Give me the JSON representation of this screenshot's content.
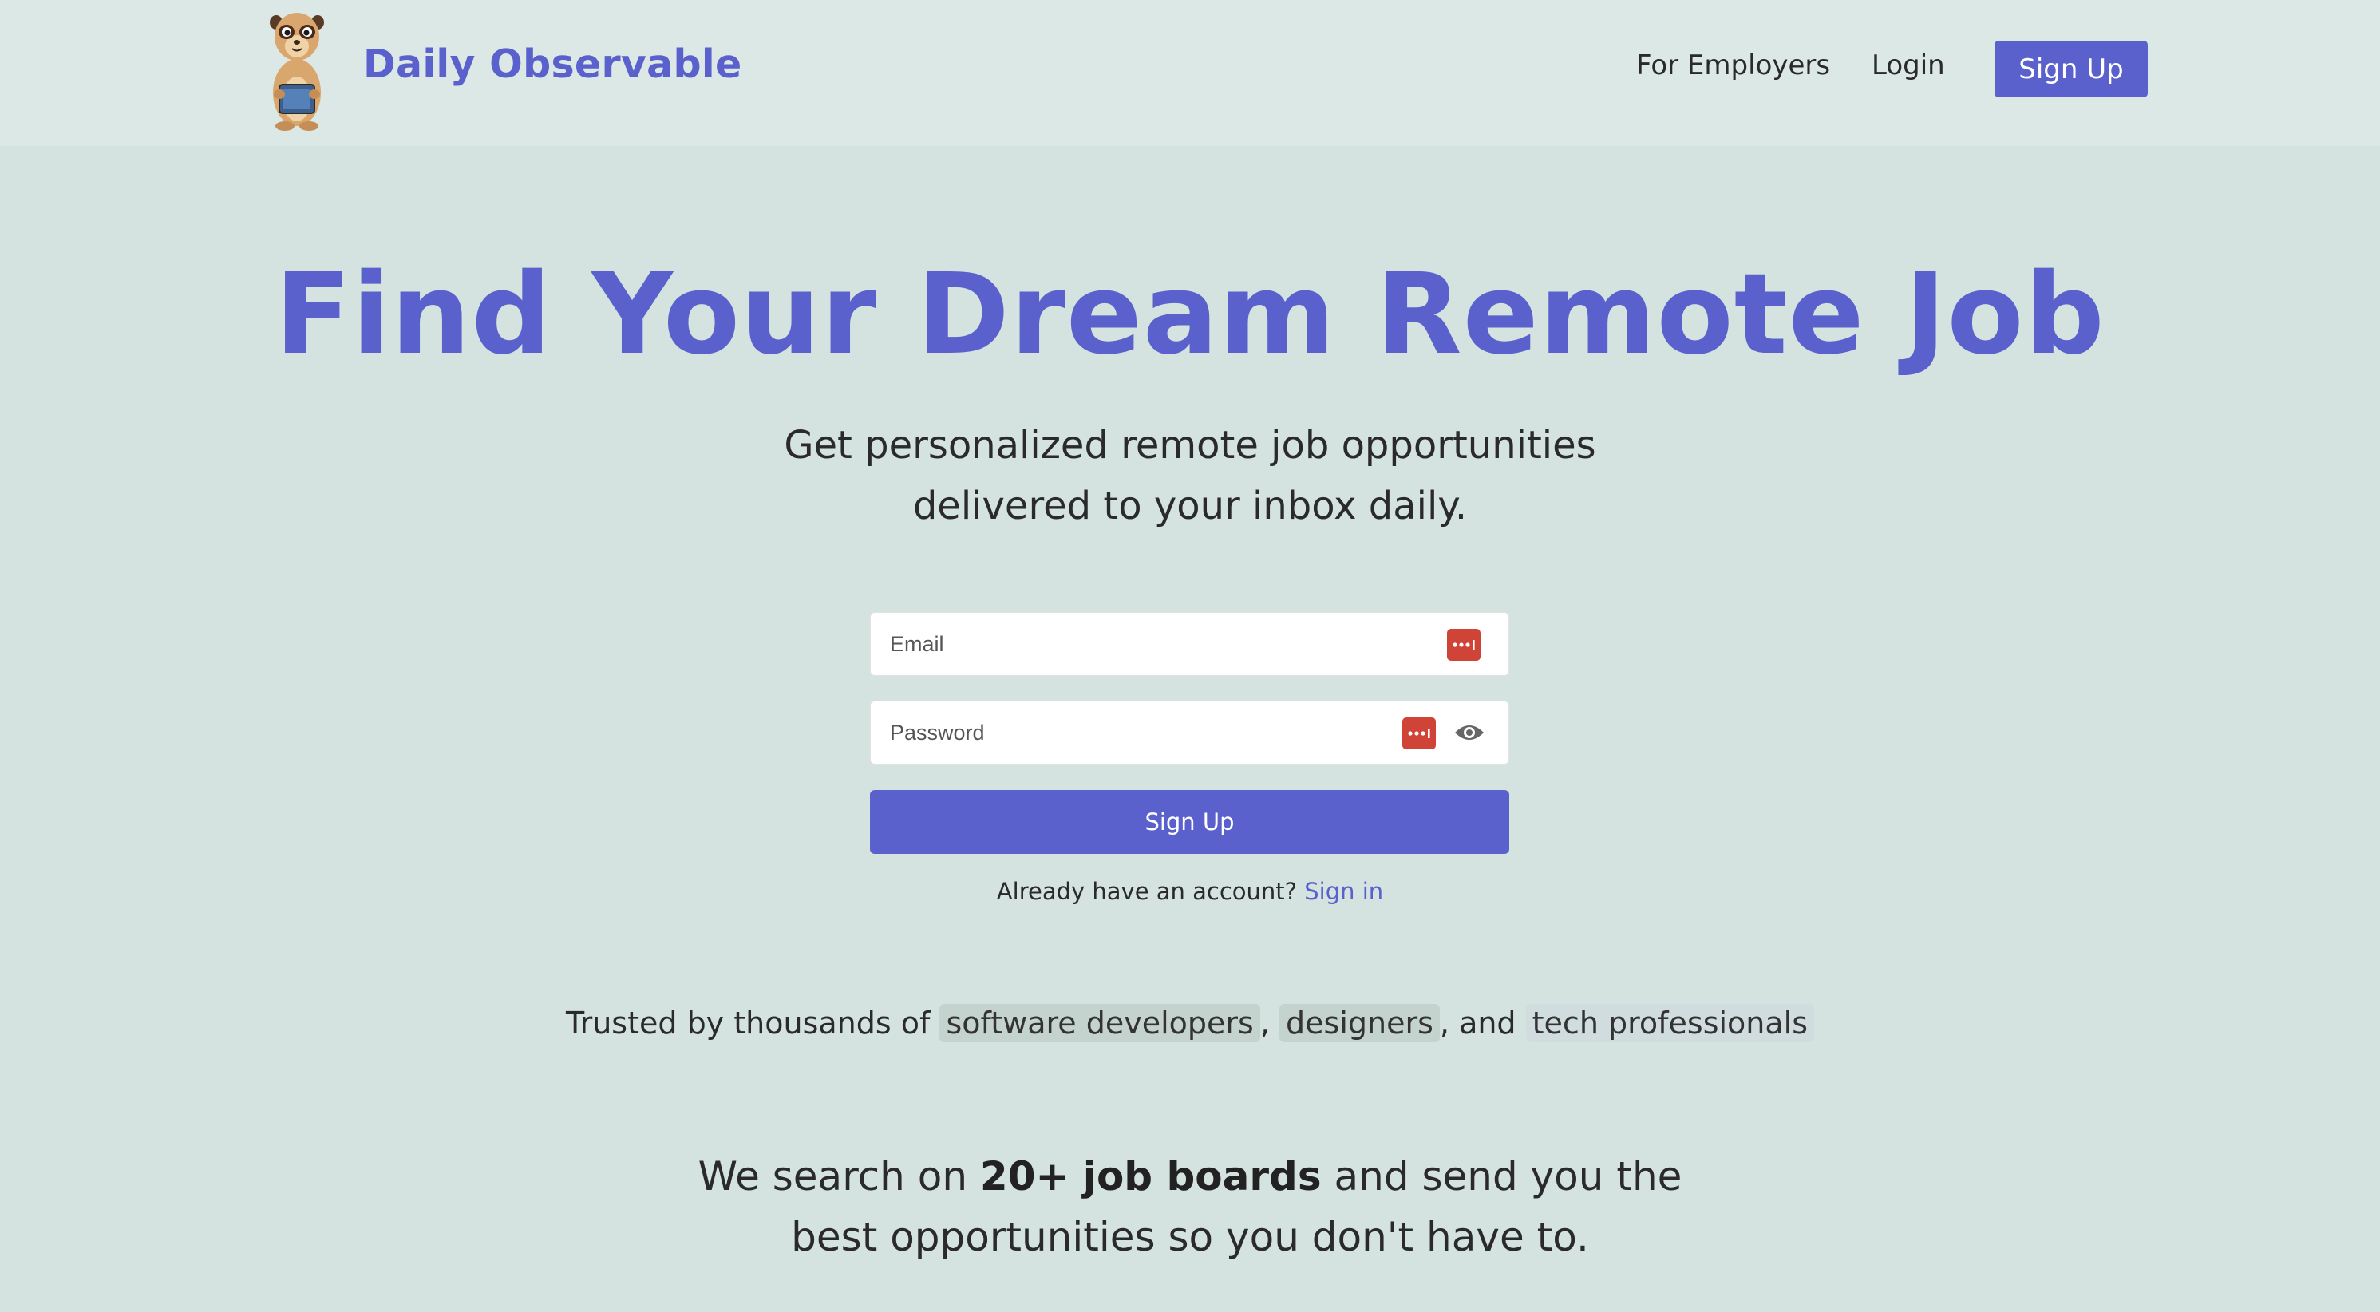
{
  "header": {
    "brand": "Daily Observable",
    "logo_icon": "meerkat-mascot-icon",
    "nav": {
      "for_employers": "For Employers",
      "login": "Login",
      "sign_up": "Sign Up"
    }
  },
  "hero": {
    "title": "Find Your Dream Remote Job",
    "subtitle_line1": "Get personalized remote job opportunities",
    "subtitle_line2": "delivered to your inbox daily."
  },
  "form": {
    "email_placeholder": "Email",
    "password_placeholder": "Password",
    "password_manager_icon": "password-manager-icon",
    "show_password_icon": "eye-icon",
    "submit_label": "Sign Up",
    "already_text": "Already have an account?",
    "sign_in_link": "Sign in"
  },
  "trusted": {
    "prefix": "Trusted by thousands of",
    "chip1": "software developers",
    "sep1": ",",
    "chip2": "designers",
    "sep2": ", and",
    "chip3": "tech professionals"
  },
  "pitch": {
    "line1_prefix": "We search on",
    "line1_bold": "20+ job boards",
    "line1_suffix": "and send you the",
    "line2": "best opportunities so you don't have to."
  },
  "colors": {
    "accent": "#5a61cc",
    "background": "#d4e3df",
    "header_background": "#dce8e5",
    "password_manager": "#cf4437"
  }
}
